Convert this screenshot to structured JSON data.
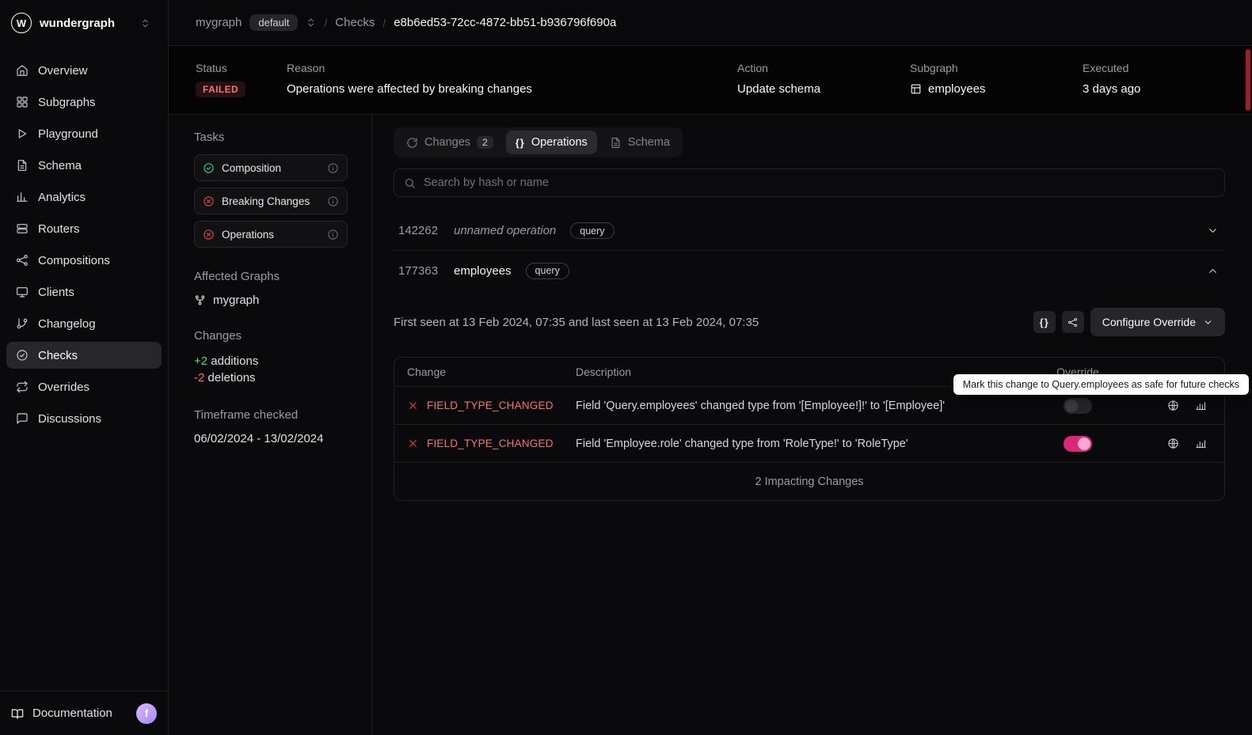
{
  "colors": {
    "accent_pink": "#db2777",
    "error_red": "#ef4444",
    "failed_text": "#f87171",
    "success_green": "#34d399",
    "additions_green": "#4ade80",
    "tooltip_bg": "#ffffff",
    "background": "#0a0a0c"
  },
  "icons": {
    "braces": "{}"
  },
  "brand": {
    "name": "wundergraph",
    "logo_letter": "W"
  },
  "breadcrumb": {
    "graph": "mygraph",
    "variant_badge": "default",
    "separator": "/",
    "section": "Checks",
    "check_id": "e8b6ed53-72cc-4872-bb51-b936796f690a"
  },
  "status_bar": {
    "status": {
      "label": "Status",
      "value": "FAILED"
    },
    "reason": {
      "label": "Reason",
      "value": "Operations were affected by breaking changes"
    },
    "action": {
      "label": "Action",
      "value": "Update schema"
    },
    "subgraph": {
      "label": "Subgraph",
      "value": "employees"
    },
    "executed": {
      "label": "Executed",
      "value": "3 days ago"
    }
  },
  "sidebar": {
    "items": [
      {
        "label": "Overview"
      },
      {
        "label": "Subgraphs"
      },
      {
        "label": "Playground"
      },
      {
        "label": "Schema"
      },
      {
        "label": "Analytics"
      },
      {
        "label": "Routers"
      },
      {
        "label": "Compositions"
      },
      {
        "label": "Clients"
      },
      {
        "label": "Changelog"
      },
      {
        "label": "Checks",
        "active": true
      },
      {
        "label": "Overrides"
      },
      {
        "label": "Discussions"
      }
    ],
    "footer": {
      "documentation_label": "Documentation",
      "avatar_initial": "f"
    }
  },
  "check_panel": {
    "tasks_title": "Tasks",
    "tasks": [
      {
        "label": "Composition",
        "status": "success"
      },
      {
        "label": "Breaking Changes",
        "status": "error"
      },
      {
        "label": "Operations",
        "status": "error"
      }
    ],
    "affected_graphs_title": "Affected Graphs",
    "affected_graph": "mygraph",
    "changes_title": "Changes",
    "additions_count": "+2",
    "additions_label": "additions",
    "deletions_count": "-2",
    "deletions_label": "deletions",
    "timeframe_title": "Timeframe checked",
    "timeframe": "06/02/2024  -  13/02/2024"
  },
  "tabs": {
    "changes": {
      "label": "Changes",
      "badge": "2"
    },
    "operations": {
      "label": "Operations"
    },
    "schema": {
      "label": "Schema"
    }
  },
  "search": {
    "placeholder": "Search by hash or name"
  },
  "operations_list": [
    {
      "hash": "142262",
      "name": "unnamed operation",
      "type_badge": "query",
      "expanded": false
    },
    {
      "hash": "177363",
      "name": "employees",
      "type_badge": "query",
      "expanded": true
    }
  ],
  "operation_detail": {
    "seen_text": "First seen at 13 Feb 2024, 07:35 and last seen at 13 Feb 2024, 07:35",
    "configure_override_label": "Configure Override",
    "table": {
      "headers": {
        "change": "Change",
        "description": "Description",
        "override": "Override"
      },
      "rows": [
        {
          "change_type": "FIELD_TYPE_CHANGED",
          "description": "Field 'Query.employees' changed type from '[Employee!]!' to '[Employee]'",
          "override_enabled": false
        },
        {
          "change_type": "FIELD_TYPE_CHANGED",
          "description": "Field 'Employee.role' changed type from 'RoleType!' to 'RoleType'",
          "override_enabled": true
        }
      ],
      "footer": "2 Impacting Changes"
    },
    "tooltip": "Mark this change to Query.employees as safe for future checks"
  }
}
